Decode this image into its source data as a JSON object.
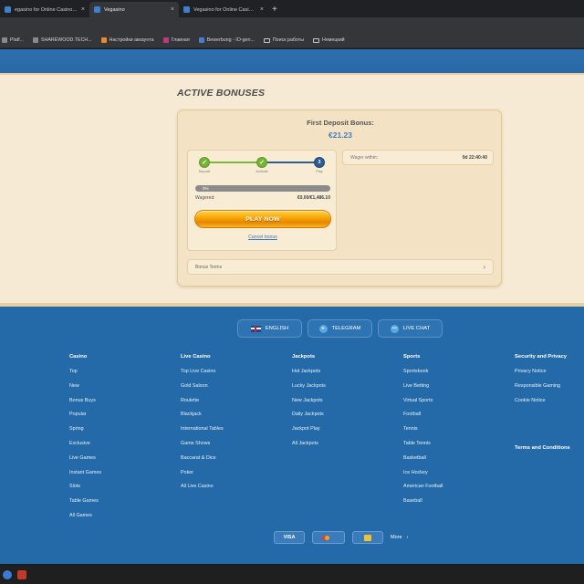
{
  "browser": {
    "tabs": [
      {
        "title": "egasino for Online Casino and",
        "active": false
      },
      {
        "title": "Vegasino",
        "active": true
      },
      {
        "title": "Vegasino for Online Casino and",
        "active": false
      }
    ],
    "close_glyph": "×",
    "new_tab_glyph": "+",
    "bookmarks": [
      {
        "label": "Platf...",
        "icon": "generic"
      },
      {
        "label": "SHAREWOOD.TECH...",
        "icon": "generic"
      },
      {
        "label": "Настройки аккаунта",
        "icon": "orange"
      },
      {
        "label": "Главная",
        "icon": "pink"
      },
      {
        "label": "Bewerbung - IO-gen...",
        "icon": "blue"
      },
      {
        "label": "Поиск работы",
        "icon": "folder"
      },
      {
        "label": "Немецкий",
        "icon": "folder"
      }
    ]
  },
  "page": {
    "title": "ACTIVE BONUSES",
    "bonus": {
      "title": "First Deposit Bonus:",
      "amount": "€21.23",
      "steps": [
        {
          "label": "Deposit",
          "state": "done",
          "glyph": "✓"
        },
        {
          "label": "Activate",
          "state": "done",
          "glyph": "✓"
        },
        {
          "label": "Play",
          "state": "current",
          "glyph": "3"
        }
      ],
      "progress_percent": 0,
      "progress_label": "0%",
      "wagered_label": "Wagered:",
      "wagered_value": "€0.00/€1,486.10",
      "play_button": "PLAY NOW",
      "cancel_link": "Cancel bonus",
      "wager_within_label": "Wager within:",
      "wager_within_value": "9d 22:40:40",
      "terms_label": "Bonus Terms",
      "terms_chevron": "›"
    }
  },
  "footer": {
    "pills": [
      {
        "label": "ENGLISH",
        "icon": "uk-flag-icon"
      },
      {
        "label": "TELEGRAM",
        "icon": "telegram-icon"
      },
      {
        "label": "LIVE CHAT",
        "icon": "chat-icon"
      }
    ],
    "columns": [
      {
        "heading": "Casino",
        "links": [
          "Top",
          "New",
          "Bonus Buys",
          "Popular",
          "Spring",
          "Exclusive",
          "Live Games",
          "Instant Games",
          "Slots",
          "Table Games",
          "All Games"
        ]
      },
      {
        "heading": "Live Casino",
        "links": [
          "Top Live Casino",
          "Gold Saloon",
          "Roulette",
          "Blackjack",
          "International Tables",
          "Game Shows",
          "Baccarat & Dice",
          "Poker",
          "All Live Casino"
        ]
      },
      {
        "heading": "Jackpots",
        "links": [
          "Hot Jackpots",
          "Lucky Jackpots",
          "New Jackpots",
          "Daily Jackpots",
          "Jackpot Play",
          "All Jackpots"
        ]
      },
      {
        "heading": "Sports",
        "links": [
          "Sportsbook",
          "Live Betting",
          "Virtual Sports",
          "Football",
          "Tennis",
          "Table Tennis",
          "Basketball",
          "Ice Hockey",
          "American Football",
          "Baseball"
        ]
      },
      {
        "heading": "Security and Privacy",
        "links": [
          "Privacy Notice",
          "Responsible Gaming",
          "Cookie Notice"
        ],
        "subheading": "Terms and Conditions"
      }
    ],
    "payments": {
      "visa": "VISA",
      "more": "More",
      "more_chevron": "›"
    }
  }
}
